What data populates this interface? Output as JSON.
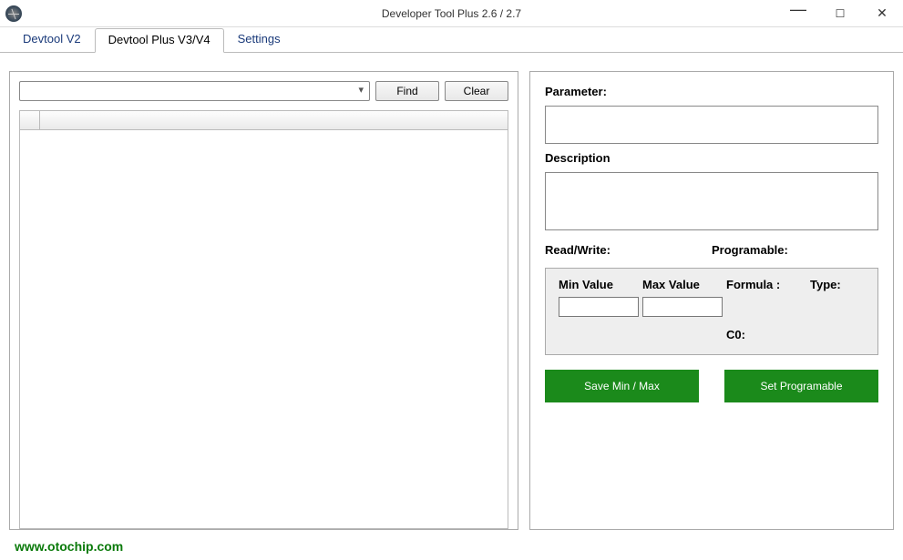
{
  "window": {
    "title": "Developer Tool Plus 2.6 / 2.7"
  },
  "tabs": {
    "t0": "Devtool V2",
    "t1": "Devtool Plus V3/V4",
    "t2": "Settings"
  },
  "left": {
    "find": "Find",
    "clear": "Clear",
    "combo_value": ""
  },
  "right": {
    "parameter_label": "Parameter:",
    "parameter_value": "",
    "description_label": "Description",
    "description_value": "",
    "readwrite_label": "Read/Write:",
    "programable_label": "Programable:",
    "min_label": "Min Value",
    "max_label": "Max Value",
    "formula_label": "Formula :",
    "type_label": "Type:",
    "c0_label": "C0:",
    "min_value": "",
    "max_value": "",
    "save_btn": "Save Min / Max",
    "setprog_btn": "Set Programable"
  },
  "footer": {
    "url": "www.otochip.com"
  }
}
